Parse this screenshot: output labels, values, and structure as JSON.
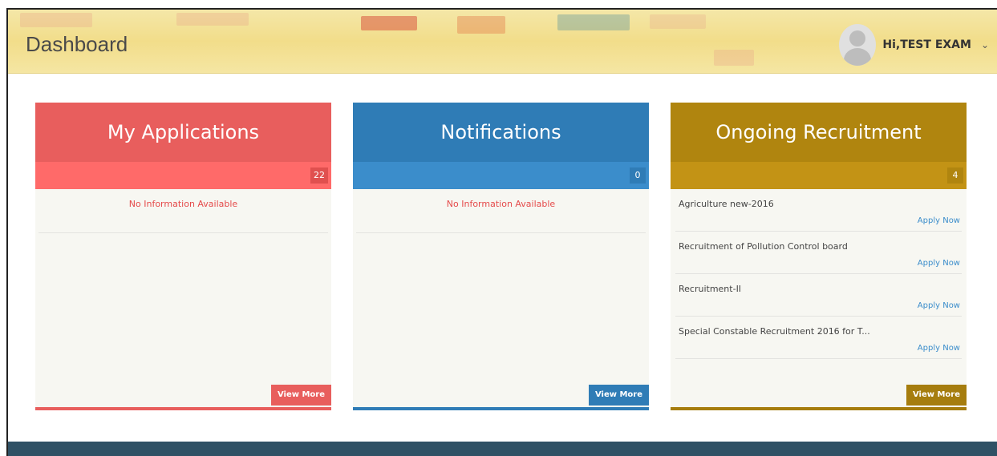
{
  "header": {
    "title": "Dashboard",
    "user_greeting": "Hi,TEST EXAM",
    "user_menu_icon": "chevron-down-icon",
    "avatar_icon": "user-avatar-icon"
  },
  "cards": {
    "applications": {
      "title": "My Applications",
      "count": "22",
      "empty_text": "No Information Available",
      "view_more": "View More",
      "color": "#e85e5d"
    },
    "notifications": {
      "title": "Notifications",
      "count": "0",
      "empty_text": "No Information Available",
      "view_more": "View More",
      "color": "#2f7cb6"
    },
    "recruitment": {
      "title": "Ongoing Recruitment",
      "count": "4",
      "view_more": "View More",
      "color": "#b0850f",
      "items": [
        {
          "name": "Agriculture new-2016",
          "action": "Apply Now"
        },
        {
          "name": "Recruitment of Pollution Control board",
          "action": "Apply Now"
        },
        {
          "name": "Recruitment-II",
          "action": "Apply Now"
        },
        {
          "name": "Special Constable Recruitment 2016 for T...",
          "action": "Apply Now"
        }
      ]
    }
  },
  "footer": {
    "color": "#2f5165"
  }
}
